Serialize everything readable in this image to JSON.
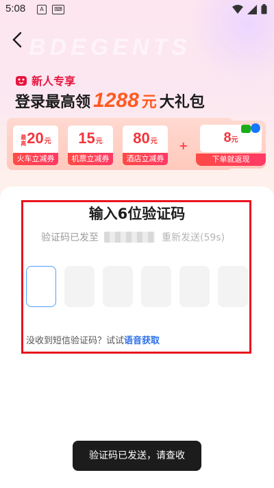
{
  "status_bar": {
    "time": "5:08",
    "left_icons": [
      "a-icon",
      "keyboard-icon"
    ],
    "right_icons": [
      "wifi-icon",
      "signal-icon",
      "battery-icon"
    ]
  },
  "header": {
    "back_icon": "chevron-left-icon",
    "watermark": "BDEGENTS"
  },
  "promo": {
    "tag_text": "新人专享",
    "headline_prefix": "登录最高领",
    "headline_amount": "1288",
    "headline_unit": "元",
    "headline_suffix": "大礼包",
    "coupons": [
      {
        "prefix": "最高",
        "amount": "20",
        "unit": "元",
        "label": "火车立减券"
      },
      {
        "prefix": "",
        "amount": "15",
        "unit": "元",
        "label": "机票立减券"
      },
      {
        "prefix": "",
        "amount": "80",
        "unit": "元",
        "label": "酒店立减券"
      }
    ],
    "plus": "+",
    "cashback": {
      "amount": "8",
      "unit": "元",
      "label": "下单就返现"
    },
    "accent_color": "#f0353b"
  },
  "verify": {
    "title": "输入6位验证码",
    "sent_prefix": "验证码已发至",
    "resend_text": "重新发送(59s)",
    "code_box_count": 6,
    "voice_prefix": "没收到短信验证码？试试",
    "voice_link": "语音获取",
    "highlight_color": "#e8141e",
    "active_border_color": "#4aa0ff"
  },
  "toast": {
    "message": "验证码已发送，请查收"
  }
}
